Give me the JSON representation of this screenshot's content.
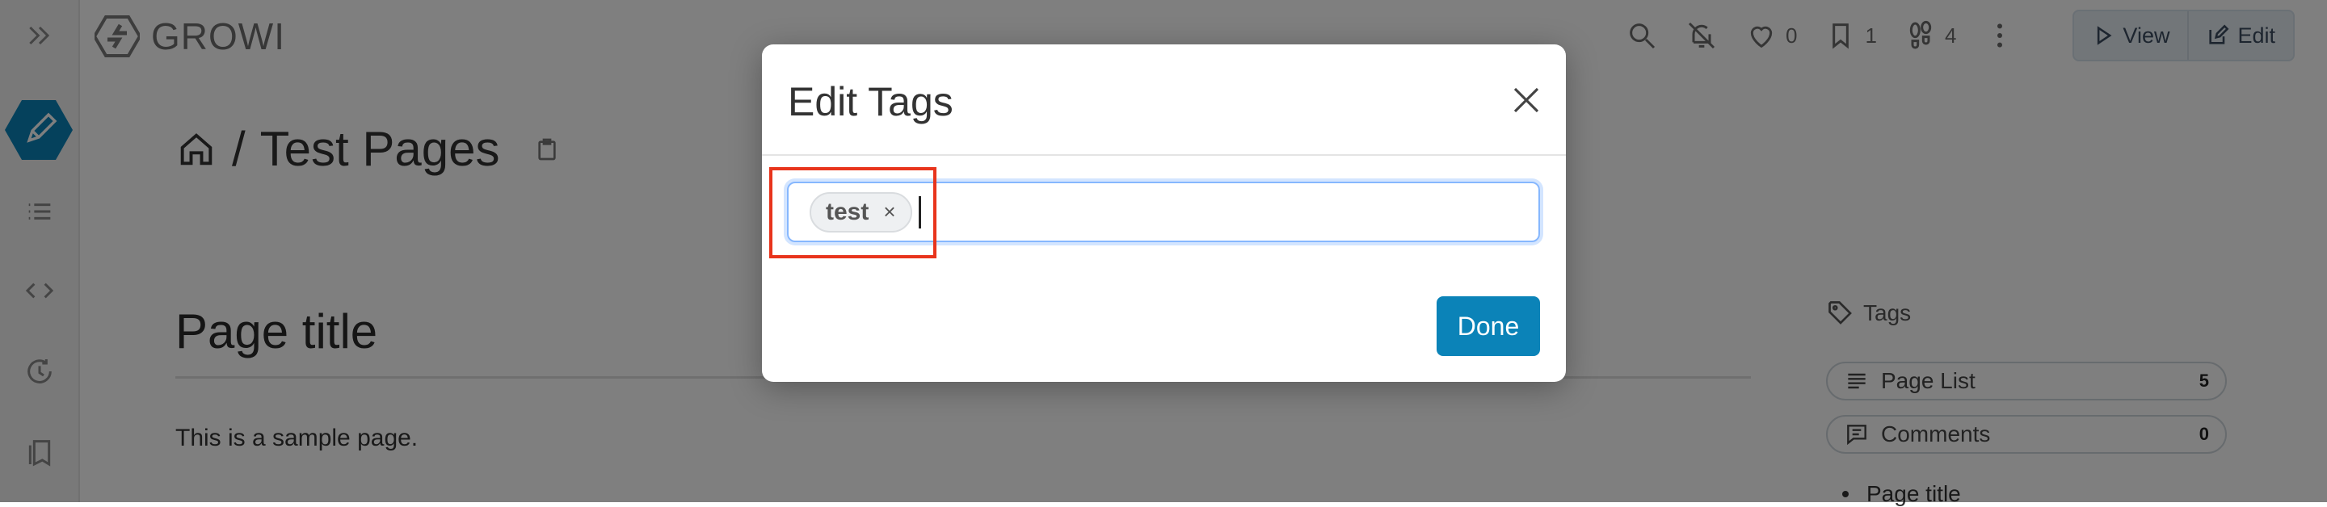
{
  "app": {
    "logo_text": "GROWI"
  },
  "topbar": {
    "likes_count": "0",
    "bookmarks_count": "1",
    "footprints_count": "4",
    "view_label": "View",
    "edit_label": "Edit"
  },
  "page": {
    "breadcrumb_separator": "/",
    "breadcrumb_title": "Test Pages",
    "heading": "Page title",
    "body_text": "This is a sample page."
  },
  "sidebar_right": {
    "tags_label": "Tags",
    "page_list_label": "Page List",
    "page_list_count": "5",
    "comments_label": "Comments",
    "comments_count": "0",
    "toc_first_item": "Page title"
  },
  "modal": {
    "title": "Edit Tags",
    "tags": [
      {
        "label": "test",
        "remove": "×"
      }
    ],
    "done_label": "Done"
  },
  "colors": {
    "accent": "#0b83b8",
    "highlight": "#e8341c"
  }
}
